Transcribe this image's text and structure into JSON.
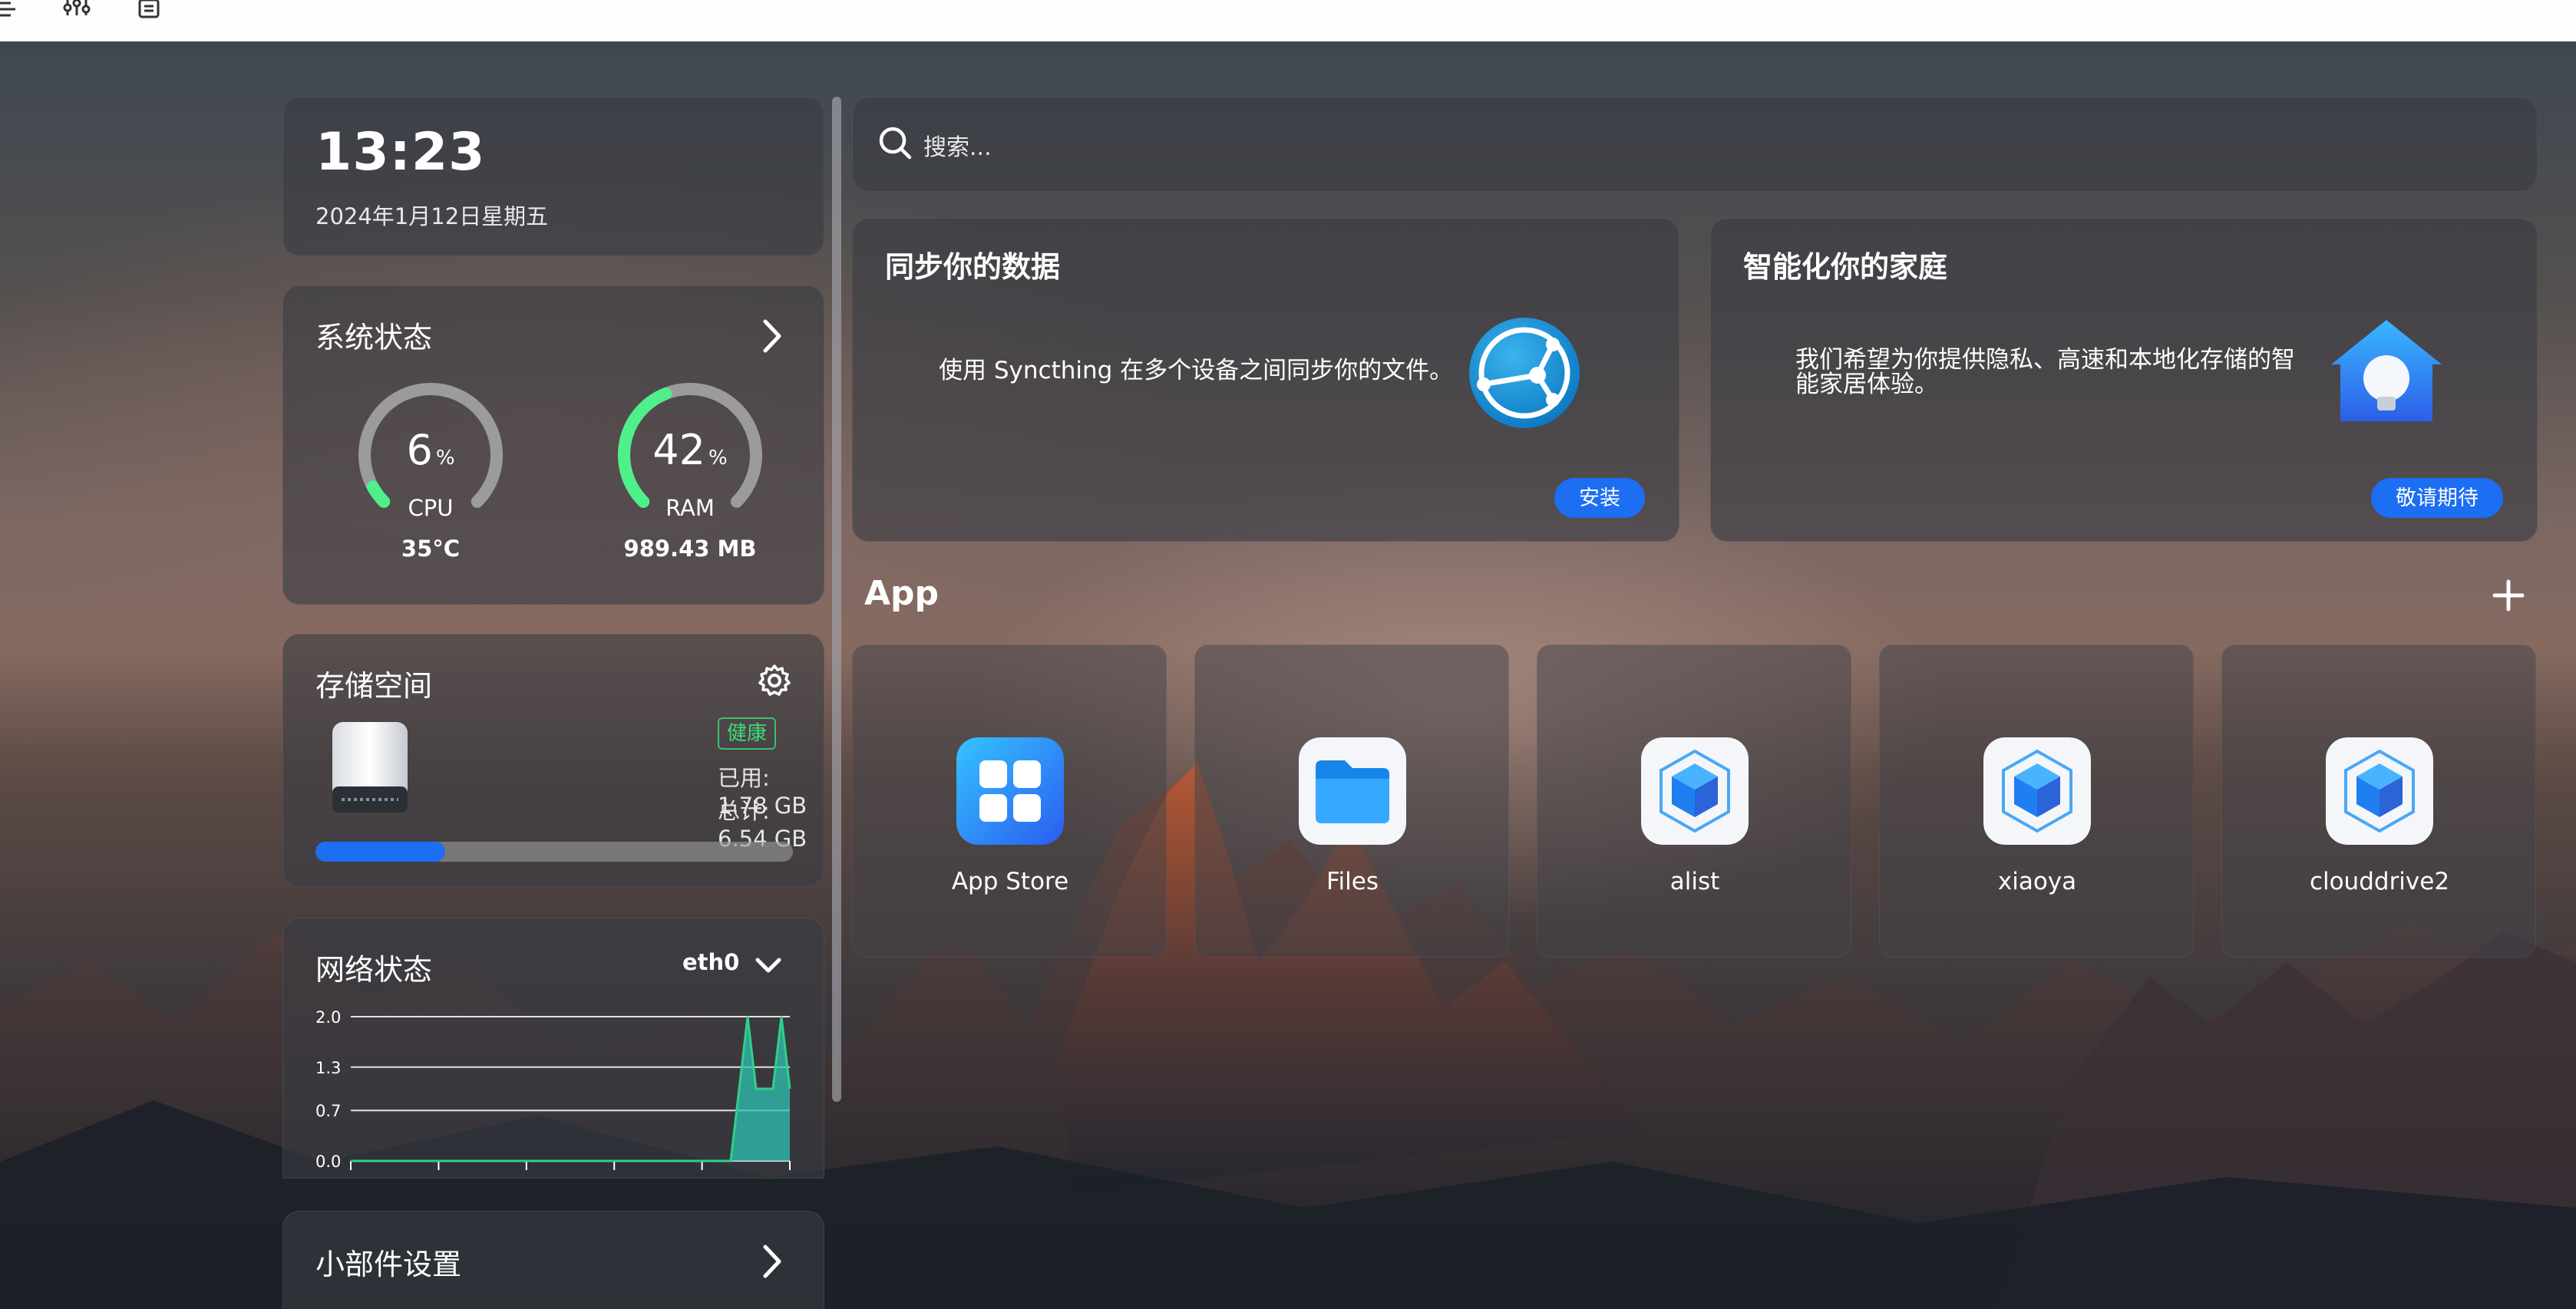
{
  "colors": {
    "accent": "#1c6ef2",
    "gauge_active": "#4ef08a",
    "gauge_track": "#9b9b9e",
    "healthy": "#3bdc7a",
    "chart_line": "#2fd08a",
    "chart_fill": "#2ec2b2"
  },
  "toolbar": {
    "icons": [
      "list-icon",
      "sliders-icon",
      "copy-icon"
    ]
  },
  "clock": {
    "time": "13:23",
    "date": "2024年1月12日星期五"
  },
  "system": {
    "title": "系统状态",
    "cpu": {
      "value": "6",
      "unit": "%",
      "label": "CPU",
      "sub": "35°C",
      "percent": 6
    },
    "ram": {
      "value": "42",
      "unit": "%",
      "label": "RAM",
      "sub": "989.43 MB",
      "percent": 42
    }
  },
  "storage": {
    "title": "存储空间",
    "badge": "健康",
    "used": "已用: 1.78 GB",
    "total": "总计: 6.54 GB",
    "used_fraction": 0.272
  },
  "network": {
    "title": "网络状态",
    "interface": "eth0",
    "chart_data": {
      "type": "area",
      "y_ticks": [
        "2.0",
        "1.3",
        "0.7",
        "0.0"
      ],
      "ylim": [
        0,
        2.0
      ],
      "grid": true,
      "series": [
        {
          "values": [
            0,
            0,
            0,
            0,
            0,
            0,
            0,
            0,
            0,
            0,
            0,
            0,
            0,
            0,
            0,
            0,
            0,
            0,
            0,
            0,
            0,
            0,
            0,
            0,
            0,
            0,
            0,
            0,
            0,
            0,
            0,
            0,
            0,
            0,
            0,
            0,
            0,
            0,
            0,
            0,
            0,
            0,
            0,
            0,
            0,
            0,
            1.0,
            2.0,
            1.0,
            1.0,
            1.0,
            2.0,
            1.0
          ]
        }
      ]
    }
  },
  "widget_settings": {
    "title": "小部件设置"
  },
  "search": {
    "placeholder": "搜索..."
  },
  "promo_sync": {
    "title": "同步你的数据",
    "desc": "使用 Syncthing 在多个设备之间同步你的文件。",
    "button": "安装"
  },
  "promo_home": {
    "title": "智能化你的家庭",
    "desc_line1": "我们希望为你提供隐私、高速和本地化存储的智",
    "desc_line2": "能家居体验。",
    "button": "敬请期待"
  },
  "apps": {
    "title": "App",
    "items": [
      {
        "name": "App Store",
        "icon": "app-store-icon"
      },
      {
        "name": "Files",
        "icon": "folder-icon"
      },
      {
        "name": "alist",
        "icon": "cube-icon"
      },
      {
        "name": "xiaoya",
        "icon": "cube-icon"
      },
      {
        "name": "clouddrive2",
        "icon": "cube-icon"
      }
    ]
  }
}
